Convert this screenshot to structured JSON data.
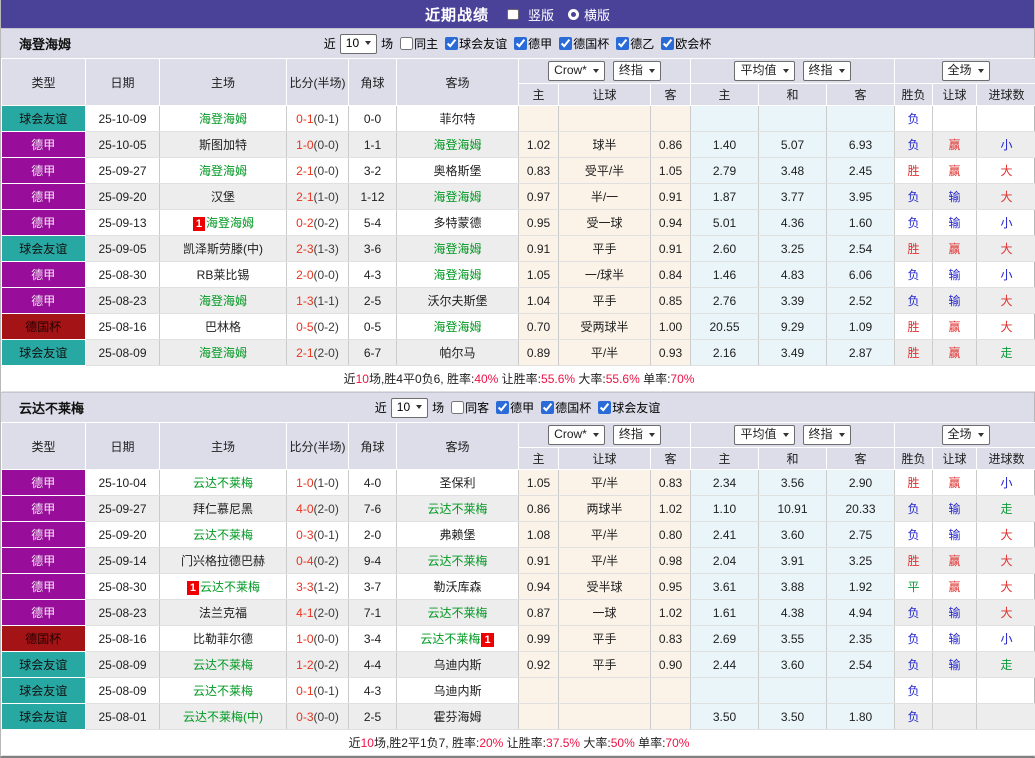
{
  "title_bar": {
    "title": "近期战绩",
    "layout_options": [
      {
        "label": "竖版",
        "selected": true
      },
      {
        "label": "横版",
        "selected": false
      }
    ]
  },
  "colors": {
    "titlebar_bg": "#4a4299",
    "header_bg": "#dcdde9",
    "league_bg": {
      "球会友谊": "#28a8a2",
      "德甲": "#990d9b",
      "德国杯": "#a41315"
    },
    "league_text": {
      "球会友谊": "#101010",
      "德甲": "#f4ecf4",
      "德国杯": "#200202"
    },
    "self_team_green": "#009922",
    "score_red": "#e8341c",
    "result_red": "#e03030",
    "result_blue": "#2323cc",
    "result_green": "#0f9a3a",
    "summary_red": "#ee1144",
    "handicap_col_tint": "#fbf3e8",
    "average_col_tint": "#eaf5f9"
  },
  "table_columns": {
    "main": [
      "类型",
      "日期",
      "主场",
      "比分(半场)",
      "角球",
      "客场"
    ],
    "group1": [
      "主",
      "让球",
      "客"
    ],
    "group2": [
      "主",
      "和",
      "客"
    ],
    "group3": [
      "胜负",
      "让球",
      "进球数"
    ]
  },
  "sections": [
    {
      "team": "海登海姆",
      "filter": {
        "near_label": "近",
        "count": "10",
        "games_label": "场",
        "same_label": "同主",
        "same_checked": false,
        "leagues": [
          {
            "label": "球会友谊",
            "checked": true
          },
          {
            "label": "德甲",
            "checked": true
          },
          {
            "label": "德国杯",
            "checked": true
          },
          {
            "label": "德乙",
            "checked": true
          },
          {
            "label": "欧会杯",
            "checked": true
          }
        ]
      },
      "selects": [
        {
          "name": "company-select",
          "value": "Crow*"
        },
        {
          "name": "company-odds-type-select",
          "value": "终指"
        },
        {
          "name": "average-select",
          "value": "平均值"
        },
        {
          "name": "average-odds-type-select",
          "value": "终指"
        },
        {
          "name": "scope-select",
          "value": "全场"
        }
      ],
      "rows": [
        {
          "league": "球会友谊",
          "date": "25-10-09",
          "home": "海登海姆",
          "home_self": true,
          "home_badge": "",
          "score": "0-1",
          "half": "(0-1)",
          "corners": "0-0",
          "away": "菲尔特",
          "away_self": false,
          "away_badge": "",
          "odds": [
            "",
            "",
            ""
          ],
          "avg": [
            "",
            "",
            ""
          ],
          "results": [
            "负",
            "",
            ""
          ]
        },
        {
          "league": "德甲",
          "date": "25-10-05",
          "home": "斯图加特",
          "home_self": false,
          "home_badge": "",
          "score": "1-0",
          "half": "(0-0)",
          "corners": "1-1",
          "away": "海登海姆",
          "away_self": true,
          "away_badge": "",
          "odds": [
            "1.02",
            "球半",
            "0.86"
          ],
          "avg": [
            "1.40",
            "5.07",
            "6.93"
          ],
          "results": [
            "负",
            "赢",
            "小"
          ]
        },
        {
          "league": "德甲",
          "date": "25-09-27",
          "home": "海登海姆",
          "home_self": true,
          "home_badge": "",
          "score": "2-1",
          "half": "(0-0)",
          "corners": "3-2",
          "away": "奥格斯堡",
          "away_self": false,
          "away_badge": "",
          "odds": [
            "0.83",
            "受平/半",
            "1.05"
          ],
          "avg": [
            "2.79",
            "3.48",
            "2.45"
          ],
          "results": [
            "胜",
            "赢",
            "大"
          ]
        },
        {
          "league": "德甲",
          "date": "25-09-20",
          "home": "汉堡",
          "home_self": false,
          "home_badge": "",
          "score": "2-1",
          "half": "(1-0)",
          "corners": "1-12",
          "away": "海登海姆",
          "away_self": true,
          "away_badge": "",
          "odds": [
            "0.97",
            "半/一",
            "0.91"
          ],
          "avg": [
            "1.87",
            "3.77",
            "3.95"
          ],
          "results": [
            "负",
            "输",
            "大"
          ]
        },
        {
          "league": "德甲",
          "date": "25-09-13",
          "home": "海登海姆",
          "home_self": true,
          "home_badge": "1",
          "score": "0-2",
          "half": "(0-2)",
          "corners": "5-4",
          "away": "多特蒙德",
          "away_self": false,
          "away_badge": "",
          "odds": [
            "0.95",
            "受一球",
            "0.94"
          ],
          "avg": [
            "5.01",
            "4.36",
            "1.60"
          ],
          "results": [
            "负",
            "输",
            "小"
          ]
        },
        {
          "league": "球会友谊",
          "date": "25-09-05",
          "home": "凯泽斯劳滕(中)",
          "home_self": false,
          "home_badge": "",
          "score": "2-3",
          "half": "(1-3)",
          "corners": "3-6",
          "away": "海登海姆",
          "away_self": true,
          "away_badge": "",
          "odds": [
            "0.91",
            "平手",
            "0.91"
          ],
          "avg": [
            "2.60",
            "3.25",
            "2.54"
          ],
          "results": [
            "胜",
            "赢",
            "大"
          ]
        },
        {
          "league": "德甲",
          "date": "25-08-30",
          "home": "RB莱比锡",
          "home_self": false,
          "home_badge": "",
          "score": "2-0",
          "half": "(0-0)",
          "corners": "4-3",
          "away": "海登海姆",
          "away_self": true,
          "away_badge": "",
          "odds": [
            "1.05",
            "一/球半",
            "0.84"
          ],
          "avg": [
            "1.46",
            "4.83",
            "6.06"
          ],
          "results": [
            "负",
            "输",
            "小"
          ]
        },
        {
          "league": "德甲",
          "date": "25-08-23",
          "home": "海登海姆",
          "home_self": true,
          "home_badge": "",
          "score": "1-3",
          "half": "(1-1)",
          "corners": "2-5",
          "away": "沃尔夫斯堡",
          "away_self": false,
          "away_badge": "",
          "odds": [
            "1.04",
            "平手",
            "0.85"
          ],
          "avg": [
            "2.76",
            "3.39",
            "2.52"
          ],
          "results": [
            "负",
            "输",
            "大"
          ]
        },
        {
          "league": "德国杯",
          "date": "25-08-16",
          "home": "巴林格",
          "home_self": false,
          "home_badge": "",
          "score": "0-5",
          "half": "(0-2)",
          "corners": "0-5",
          "away": "海登海姆",
          "away_self": true,
          "away_badge": "",
          "odds": [
            "0.70",
            "受两球半",
            "1.00"
          ],
          "avg": [
            "20.55",
            "9.29",
            "1.09"
          ],
          "results": [
            "胜",
            "赢",
            "大"
          ]
        },
        {
          "league": "球会友谊",
          "date": "25-08-09",
          "home": "海登海姆",
          "home_self": true,
          "home_badge": "",
          "score": "2-1",
          "half": "(2-0)",
          "corners": "6-7",
          "away": "帕尔马",
          "away_self": false,
          "away_badge": "",
          "odds": [
            "0.89",
            "平/半",
            "0.93"
          ],
          "avg": [
            "2.16",
            "3.49",
            "2.87"
          ],
          "results": [
            "胜",
            "赢",
            "走"
          ]
        }
      ],
      "summary": [
        {
          "text": "近"
        },
        {
          "text": "10",
          "red": true
        },
        {
          "text": "场,胜4平0负6, 胜率:"
        },
        {
          "text": "40%",
          "red": true
        },
        {
          "text": " 让胜率:"
        },
        {
          "text": "55.6%",
          "red": true
        },
        {
          "text": " 大率:"
        },
        {
          "text": "55.6%",
          "red": true
        },
        {
          "text": " 单率:"
        },
        {
          "text": "70%",
          "red": true
        }
      ]
    },
    {
      "team": "云达不莱梅",
      "filter": {
        "near_label": "近",
        "count": "10",
        "games_label": "场",
        "same_label": "同客",
        "same_checked": false,
        "leagues": [
          {
            "label": "德甲",
            "checked": true
          },
          {
            "label": "德国杯",
            "checked": true
          },
          {
            "label": "球会友谊",
            "checked": true
          }
        ]
      },
      "selects": [
        {
          "name": "company-select",
          "value": "Crow*"
        },
        {
          "name": "company-odds-type-select",
          "value": "终指"
        },
        {
          "name": "average-select",
          "value": "平均值"
        },
        {
          "name": "average-odds-type-select",
          "value": "终指"
        },
        {
          "name": "scope-select",
          "value": "全场"
        }
      ],
      "rows": [
        {
          "league": "德甲",
          "date": "25-10-04",
          "home": "云达不莱梅",
          "home_self": true,
          "home_badge": "",
          "score": "1-0",
          "half": "(1-0)",
          "corners": "4-0",
          "away": "圣保利",
          "away_self": false,
          "away_badge": "",
          "odds": [
            "1.05",
            "平/半",
            "0.83"
          ],
          "avg": [
            "2.34",
            "3.56",
            "2.90"
          ],
          "results": [
            "胜",
            "赢",
            "小"
          ]
        },
        {
          "league": "德甲",
          "date": "25-09-27",
          "home": "拜仁慕尼黑",
          "home_self": false,
          "home_badge": "",
          "score": "4-0",
          "half": "(2-0)",
          "corners": "7-6",
          "away": "云达不莱梅",
          "away_self": true,
          "away_badge": "",
          "odds": [
            "0.86",
            "两球半",
            "1.02"
          ],
          "avg": [
            "1.10",
            "10.91",
            "20.33"
          ],
          "results": [
            "负",
            "输",
            "走"
          ]
        },
        {
          "league": "德甲",
          "date": "25-09-20",
          "home": "云达不莱梅",
          "home_self": true,
          "home_badge": "",
          "score": "0-3",
          "half": "(0-1)",
          "corners": "2-0",
          "away": "弗赖堡",
          "away_self": false,
          "away_badge": "",
          "odds": [
            "1.08",
            "平/半",
            "0.80"
          ],
          "avg": [
            "2.41",
            "3.60",
            "2.75"
          ],
          "results": [
            "负",
            "输",
            "大"
          ]
        },
        {
          "league": "德甲",
          "date": "25-09-14",
          "home": "门兴格拉德巴赫",
          "home_self": false,
          "home_badge": "",
          "score": "0-4",
          "half": "(0-2)",
          "corners": "9-4",
          "away": "云达不莱梅",
          "away_self": true,
          "away_badge": "",
          "odds": [
            "0.91",
            "平/半",
            "0.98"
          ],
          "avg": [
            "2.04",
            "3.91",
            "3.25"
          ],
          "results": [
            "胜",
            "赢",
            "大"
          ]
        },
        {
          "league": "德甲",
          "date": "25-08-30",
          "home": "云达不莱梅",
          "home_self": true,
          "home_badge": "1",
          "score": "3-3",
          "half": "(1-2)",
          "corners": "3-7",
          "away": "勒沃库森",
          "away_self": false,
          "away_badge": "",
          "odds": [
            "0.94",
            "受半球",
            "0.95"
          ],
          "avg": [
            "3.61",
            "3.88",
            "1.92"
          ],
          "results": [
            "平",
            "赢",
            "大"
          ]
        },
        {
          "league": "德甲",
          "date": "25-08-23",
          "home": "法兰克福",
          "home_self": false,
          "home_badge": "",
          "score": "4-1",
          "half": "(2-0)",
          "corners": "7-1",
          "away": "云达不莱梅",
          "away_self": true,
          "away_badge": "",
          "odds": [
            "0.87",
            "一球",
            "1.02"
          ],
          "avg": [
            "1.61",
            "4.38",
            "4.94"
          ],
          "results": [
            "负",
            "输",
            "大"
          ]
        },
        {
          "league": "德国杯",
          "date": "25-08-16",
          "home": "比勒菲尔德",
          "home_self": false,
          "home_badge": "",
          "score": "1-0",
          "half": "(0-0)",
          "corners": "3-4",
          "away": "云达不莱梅",
          "away_self": true,
          "away_badge": "1",
          "odds": [
            "0.99",
            "平手",
            "0.83"
          ],
          "avg": [
            "2.69",
            "3.55",
            "2.35"
          ],
          "results": [
            "负",
            "输",
            "小"
          ]
        },
        {
          "league": "球会友谊",
          "date": "25-08-09",
          "home": "云达不莱梅",
          "home_self": true,
          "home_badge": "",
          "score": "1-2",
          "half": "(0-2)",
          "corners": "4-4",
          "away": "乌迪内斯",
          "away_self": false,
          "away_badge": "",
          "odds": [
            "0.92",
            "平手",
            "0.90"
          ],
          "avg": [
            "2.44",
            "3.60",
            "2.54"
          ],
          "results": [
            "负",
            "输",
            "走"
          ]
        },
        {
          "league": "球会友谊",
          "date": "25-08-09",
          "home": "云达不莱梅",
          "home_self": true,
          "home_badge": "",
          "score": "0-1",
          "half": "(0-1)",
          "corners": "4-3",
          "away": "乌迪内斯",
          "away_self": false,
          "away_badge": "",
          "odds": [
            "",
            "",
            ""
          ],
          "avg": [
            "",
            "",
            ""
          ],
          "results": [
            "负",
            "",
            ""
          ]
        },
        {
          "league": "球会友谊",
          "date": "25-08-01",
          "home": "云达不莱梅(中)",
          "home_self": true,
          "home_badge": "",
          "score": "0-3",
          "half": "(0-0)",
          "corners": "2-5",
          "away": "霍芬海姆",
          "away_self": false,
          "away_badge": "",
          "odds": [
            "",
            "",
            ""
          ],
          "avg": [
            "3.50",
            "3.50",
            "1.80"
          ],
          "results": [
            "负",
            "",
            ""
          ]
        }
      ],
      "summary": [
        {
          "text": "近"
        },
        {
          "text": "10",
          "red": true
        },
        {
          "text": "场,胜2平1负7, 胜率:"
        },
        {
          "text": "20%",
          "red": true
        },
        {
          "text": " 让胜率:"
        },
        {
          "text": "37.5%",
          "red": true
        },
        {
          "text": " 大率:"
        },
        {
          "text": "50%",
          "red": true
        },
        {
          "text": " 单率:"
        },
        {
          "text": "70%",
          "red": true
        }
      ]
    }
  ]
}
